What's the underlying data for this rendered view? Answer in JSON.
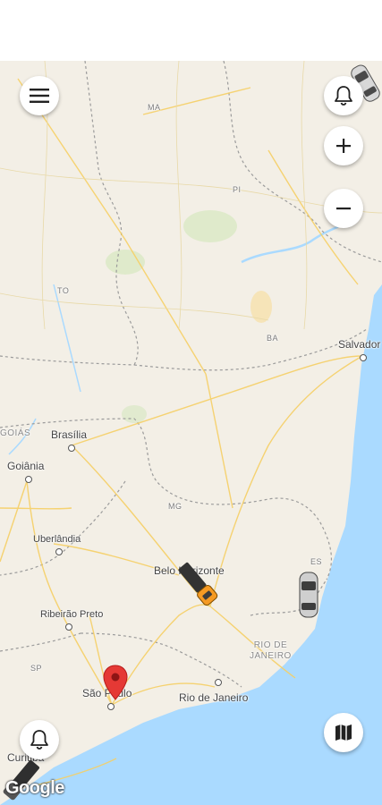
{
  "buttons": {
    "menu_icon": "menu-icon",
    "notifications_top_icon": "bell-icon",
    "zoom_in_icon": "plus-icon",
    "zoom_out_icon": "minus-icon",
    "notifications_bottom_icon": "bell-icon",
    "map_layers_icon": "map-icon"
  },
  "map": {
    "attribution": "Google",
    "regions": {
      "ma": "MA",
      "pi": "PI",
      "to": "TO",
      "ba": "BA",
      "mg": "MG",
      "es": "ES",
      "sp": "SP",
      "goias": "GOIÁS",
      "rio_state": "RIO DE\nJANEIRO"
    },
    "cities": {
      "salvador": "Salvador",
      "brasilia": "Brasília",
      "goiania": "Goiânia",
      "uberlandia": "Uberlândia",
      "belo_horizonte": "Belo Horizonte",
      "ribeirao_preto": "Ribeirão Preto",
      "sao_paulo": "São Paulo",
      "rio_de_janeiro": "Rio de Janeiro",
      "curitiba": "Curitiba"
    },
    "colors": {
      "land": "#f3efe6",
      "ocean": "#aadaff",
      "roads": "#f6cf65",
      "marker": "#e53935"
    }
  }
}
